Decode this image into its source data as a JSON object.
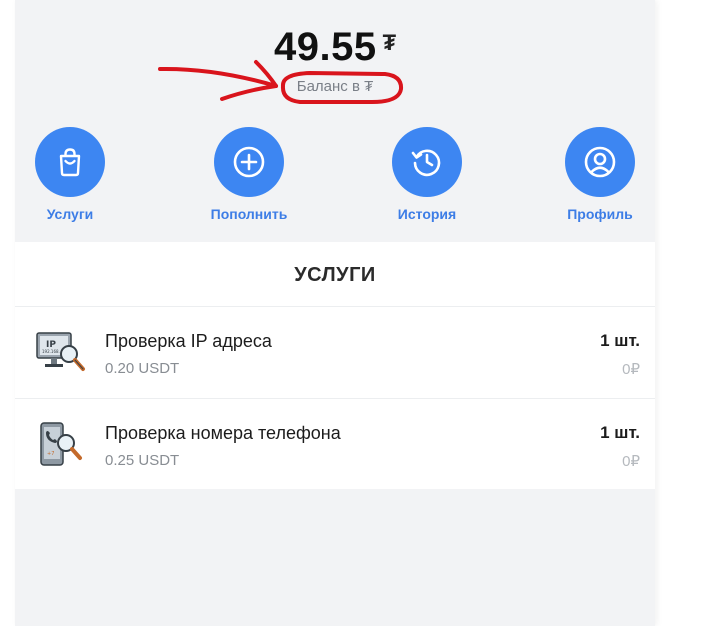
{
  "balance": {
    "value": "49.55",
    "currency": "₮",
    "label": "Баланс в ₮"
  },
  "nav": [
    {
      "label": "Услуги",
      "icon": "shopping-bag-icon"
    },
    {
      "label": "Пополнить",
      "icon": "plus-circle-icon"
    },
    {
      "label": "История",
      "icon": "history-icon"
    },
    {
      "label": "Профиль",
      "icon": "profile-icon"
    }
  ],
  "services": {
    "title": "УСЛУГИ",
    "items": [
      {
        "name": "Проверка IP адреса",
        "price": "0.20 USDT",
        "qty": "1 шт.",
        "rub": "0₽",
        "icon": "ip-monitor-search-icon"
      },
      {
        "name": "Проверка номера телефона",
        "price": "0.25 USDT",
        "qty": "1 шт.",
        "rub": "0₽",
        "icon": "phone-search-icon"
      }
    ]
  },
  "colors": {
    "accent": "#3d86f2",
    "accent_text": "#3d7de6",
    "background": "#f2f3f5",
    "annotation": "#d9141c"
  }
}
